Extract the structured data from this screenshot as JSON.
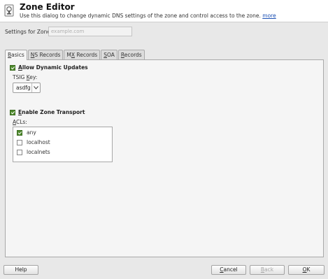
{
  "header": {
    "title": "Zone Editor",
    "description": "Use this dialog to change dynamic DNS settings of the zone and control access to the zone.",
    "more_link": "more",
    "icon": "dns-zone-icon"
  },
  "zone": {
    "label": "Settings for Zone",
    "placeholder": "example.com"
  },
  "tabs": [
    {
      "pre": "",
      "acc": "B",
      "post": "asics",
      "active": true
    },
    {
      "pre": "",
      "acc": "N",
      "post": "S Records",
      "active": false
    },
    {
      "pre": "M",
      "acc": "X",
      "post": " Records",
      "active": false
    },
    {
      "pre": "",
      "acc": "S",
      "post": "OA",
      "active": false
    },
    {
      "pre": "",
      "acc": "R",
      "post": "ecords",
      "active": false
    }
  ],
  "basics": {
    "allow_updates": {
      "pre": "",
      "acc": "A",
      "post": "llow Dynamic Updates",
      "checked": true
    },
    "tsig_label_pre": "TSIG ",
    "tsig_label_acc": "K",
    "tsig_label_post": "ey:",
    "tsig_value": "asdfg",
    "enable_transport": {
      "pre": "",
      "acc": "E",
      "post": "nable Zone Transport",
      "checked": true
    },
    "acls_label_acc": "A",
    "acls_label_post": "CLs:",
    "acls": [
      {
        "label": "any",
        "checked": true
      },
      {
        "label": "localhost",
        "checked": false
      },
      {
        "label": "localnets",
        "checked": false
      }
    ]
  },
  "buttons": {
    "help": "Help",
    "cancel_acc": "C",
    "cancel_post": "ancel",
    "back_acc": "B",
    "back_post": "ack",
    "ok_acc": "O",
    "ok_post": "K"
  },
  "colors": {
    "checkbox_checked": "#4e8a2c",
    "link": "#1a4fb4"
  }
}
